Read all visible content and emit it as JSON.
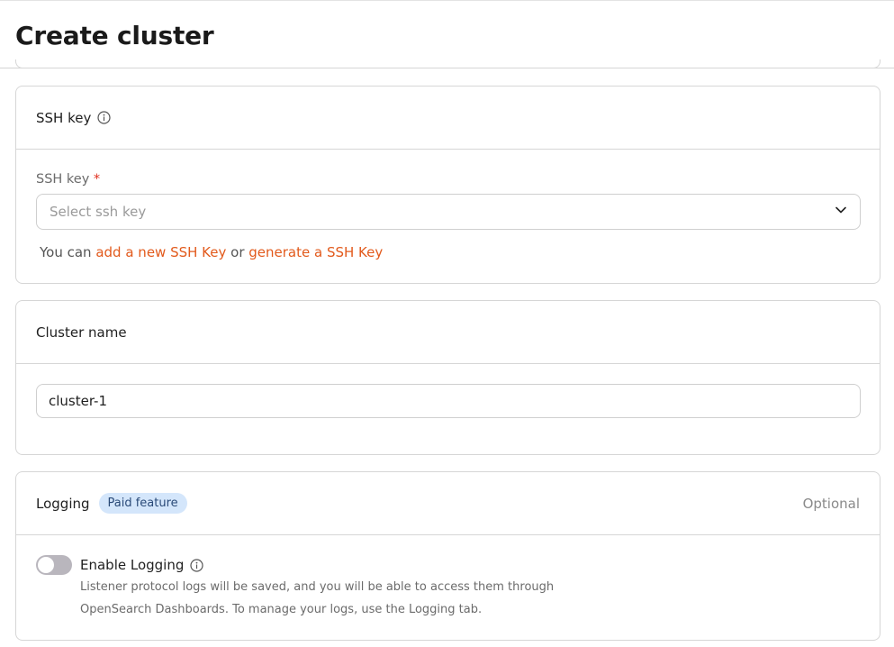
{
  "header": {
    "title": "Create cluster"
  },
  "ssh_section": {
    "title": "SSH key",
    "field_label": "SSH key",
    "required_mark": "*",
    "select_placeholder": "Select ssh key",
    "helper_prefix": "You can ",
    "link_add": "add a new SSH Key",
    "helper_mid": " or ",
    "link_generate": "generate a SSH Key"
  },
  "cluster_section": {
    "title": "Cluster name",
    "name_value": "cluster-1"
  },
  "logging_section": {
    "title": "Logging",
    "badge": "Paid feature",
    "optional": "Optional",
    "toggle_label": "Enable Logging",
    "toggle_on": false,
    "desc_line1": "Listener protocol logs will be saved, and you will be able to access them through",
    "desc_line2": "OpenSearch Dashboards. To manage your logs, use the Logging tab."
  },
  "colors": {
    "accent_link": "#e25a1c",
    "required": "#e02f1f",
    "badge_bg": "#d4e6fb",
    "toggle_off": "#b9b6bd"
  }
}
